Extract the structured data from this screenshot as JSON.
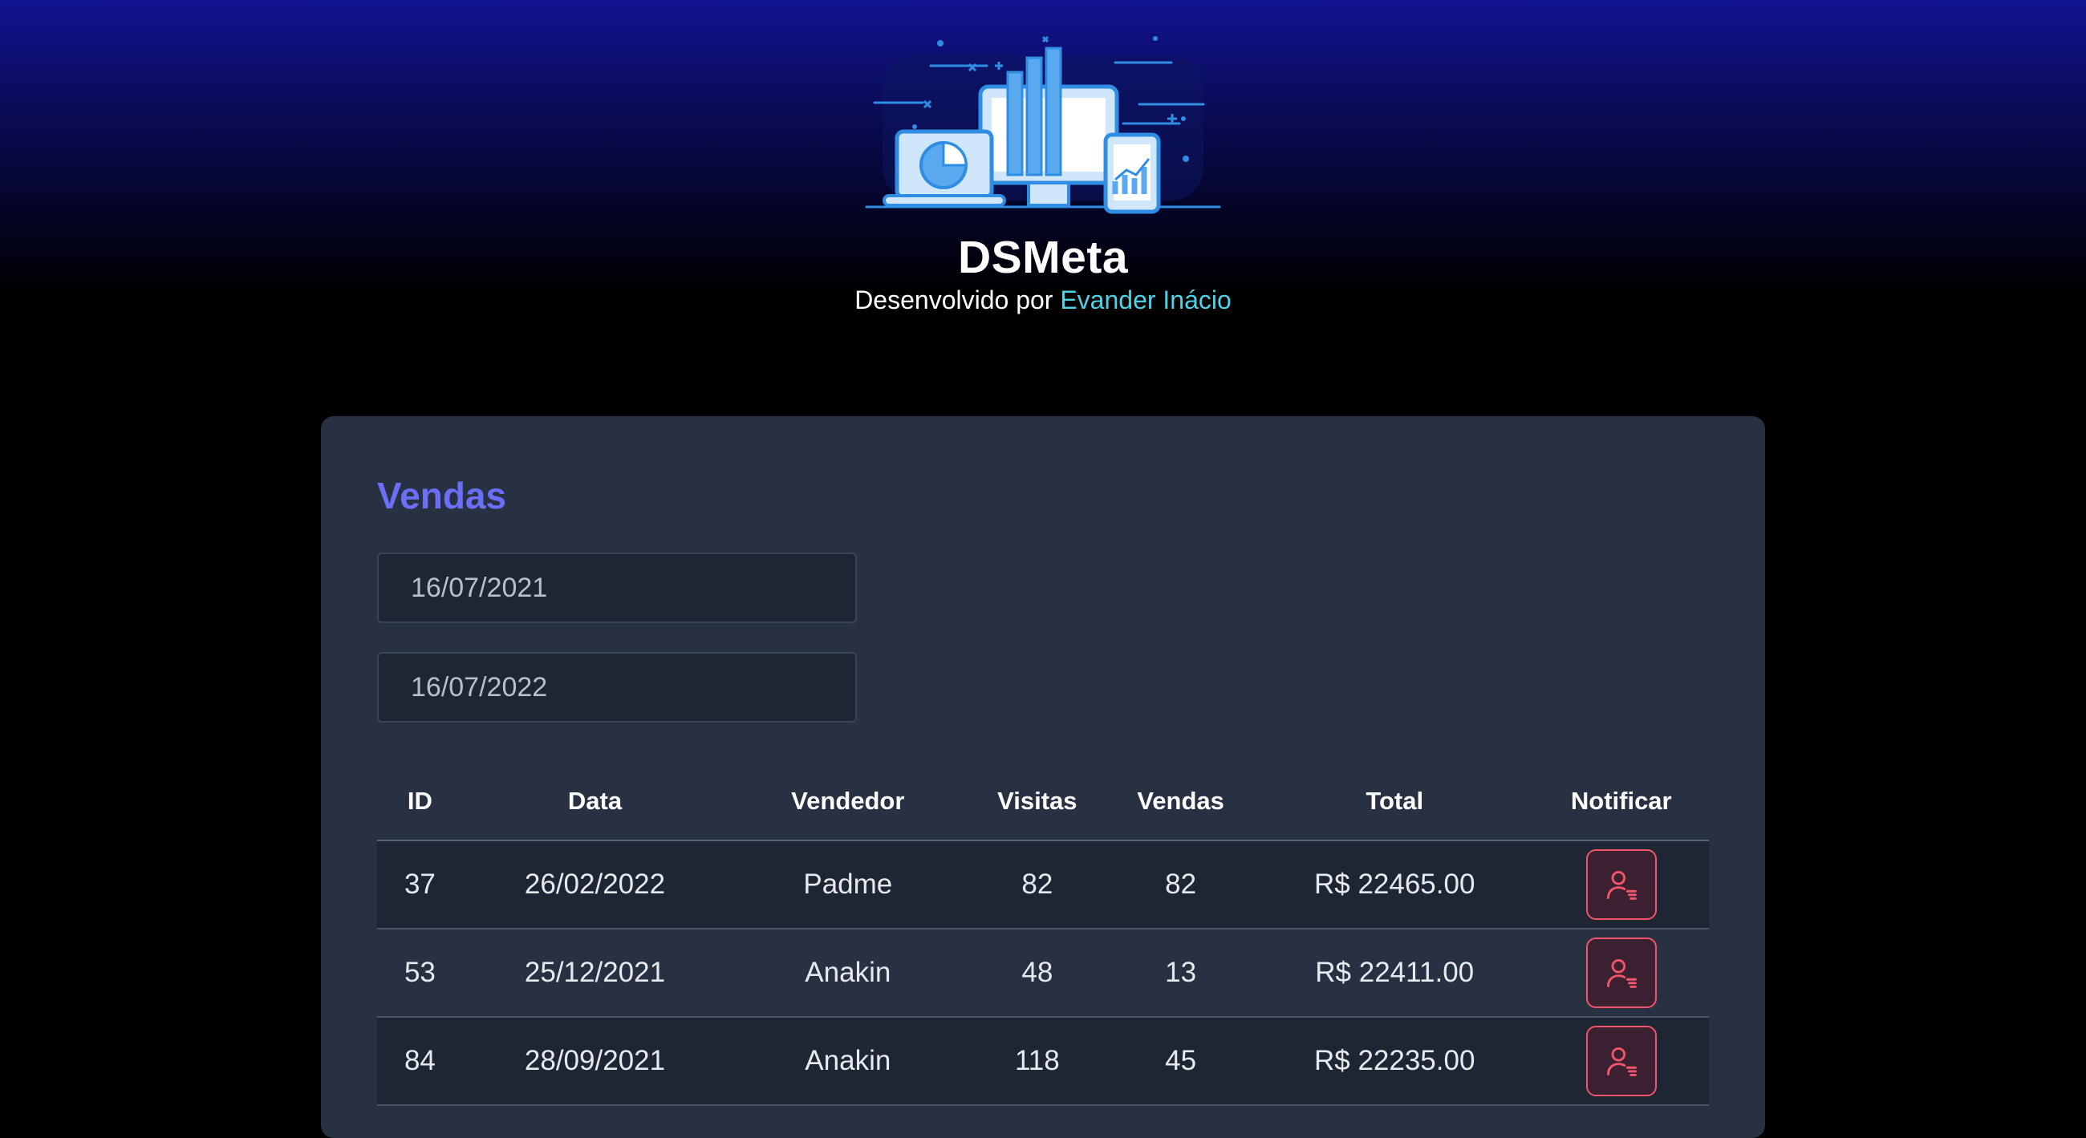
{
  "header": {
    "app_title": "DSMeta",
    "byline_prefix": "Desenvolvido por ",
    "byline_author": "Evander Inácio"
  },
  "sales": {
    "title": "Vendas",
    "min_date": "16/07/2021",
    "max_date": "16/07/2022",
    "columns": [
      "ID",
      "Data",
      "Vendedor",
      "Visitas",
      "Vendas",
      "Total",
      "Notificar"
    ],
    "rows": [
      {
        "id": "37",
        "date": "26/02/2022",
        "seller": "Padme",
        "visits": "82",
        "sales": "82",
        "total": "R$ 22465.00"
      },
      {
        "id": "53",
        "date": "25/12/2021",
        "seller": "Anakin",
        "visits": "48",
        "sales": "13",
        "total": "R$ 22411.00"
      },
      {
        "id": "84",
        "date": "28/09/2021",
        "seller": "Anakin",
        "visits": "118",
        "sales": "45",
        "total": "R$ 22235.00"
      }
    ],
    "notify_icon": "user-notify-icon"
  },
  "colors": {
    "accent": "#6b6ef7",
    "link": "#4fd1e6",
    "notify": "#f0556a",
    "card": "#283142"
  }
}
